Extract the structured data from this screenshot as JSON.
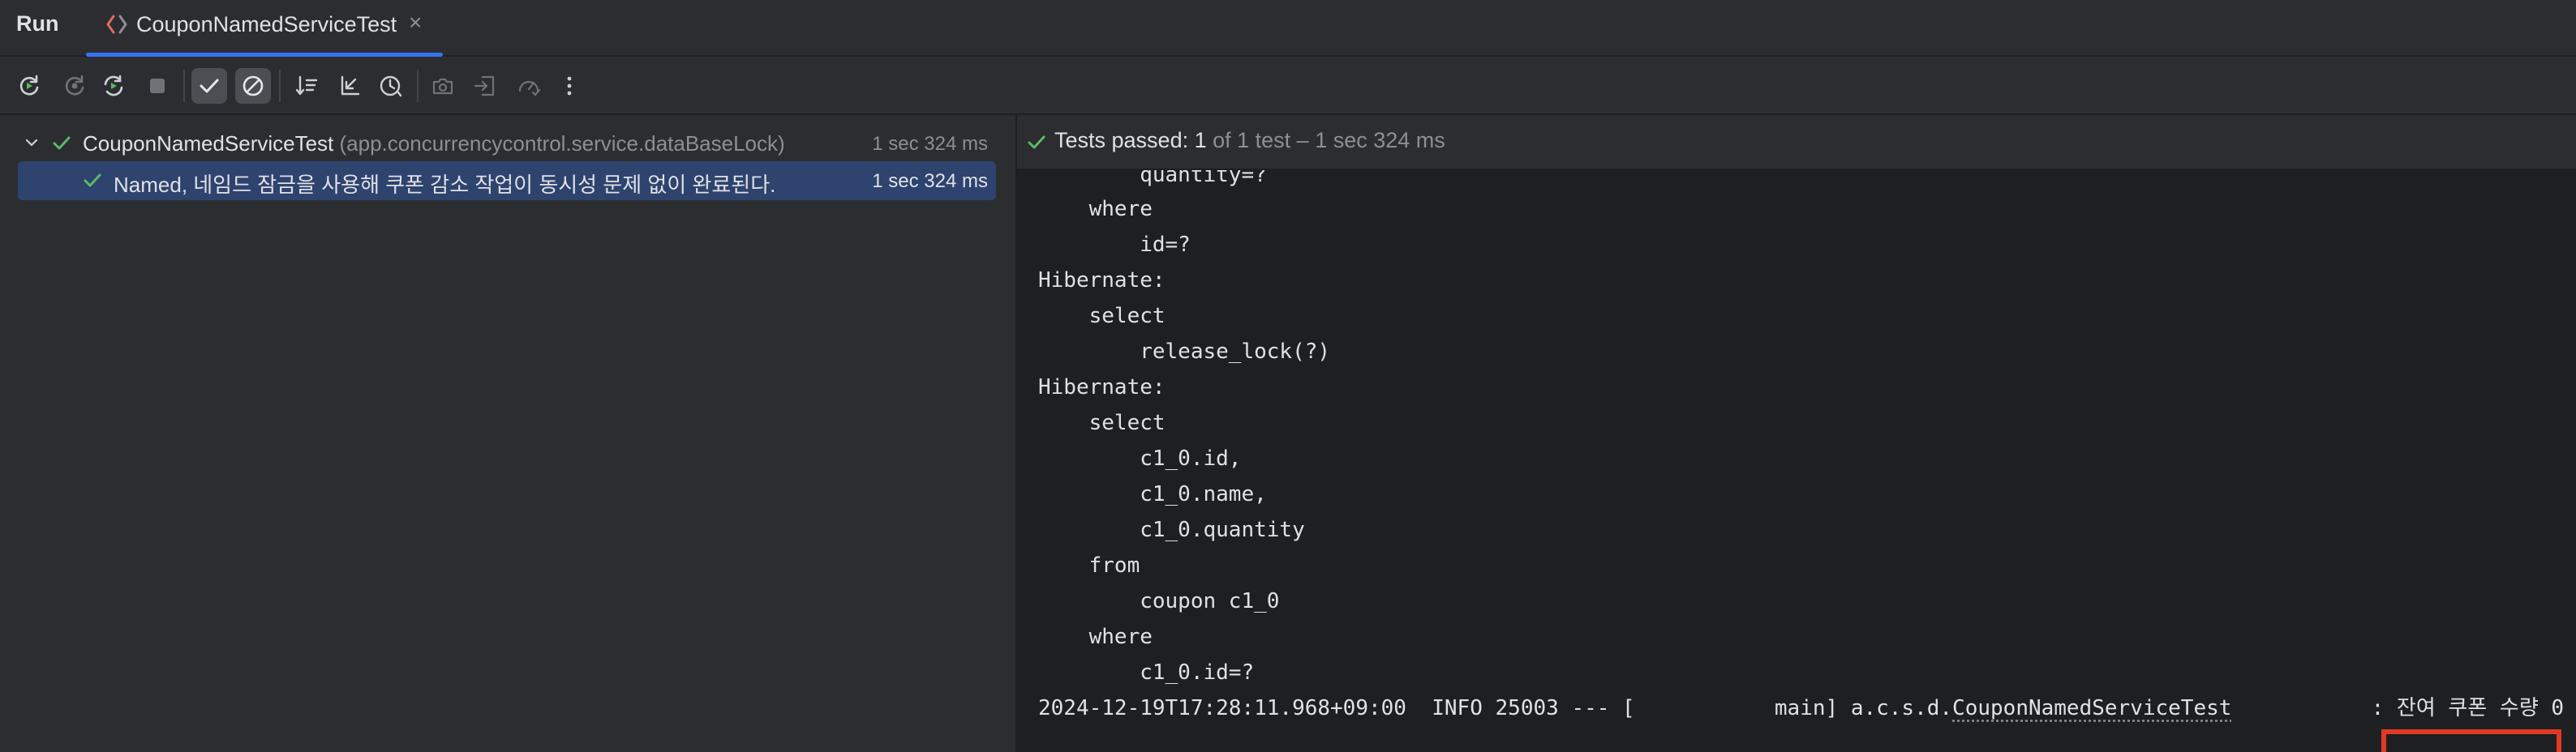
{
  "tabbar": {
    "run_label": "Run",
    "tab_title": "CouponNamedServiceTest",
    "close_glyph": "×"
  },
  "toolbar": {
    "buttons": [
      {
        "name": "rerun-icon"
      },
      {
        "name": "rerun-failed-icon"
      },
      {
        "name": "toggle-auto-test-icon"
      },
      {
        "name": "stop-icon"
      },
      {
        "name": "show-passed-icon"
      },
      {
        "name": "show-ignored-icon"
      },
      {
        "name": "sort-alphabetically-icon"
      },
      {
        "name": "collapse-all-icon"
      },
      {
        "name": "sort-by-duration-icon"
      },
      {
        "name": "camera-icon"
      },
      {
        "name": "import-tests-icon"
      },
      {
        "name": "gauge-icon"
      },
      {
        "name": "more-options-icon"
      }
    ]
  },
  "tree": {
    "root": {
      "name": "CouponNamedServiceTest",
      "package": "(app.concurrencycontrol.service.dataBaseLock)",
      "time": "1 sec 324 ms"
    },
    "child": {
      "name": "Named, 네임드 잠금을 사용해 쿠폰 감소 작업이 동시성 문제 없이 완료된다.",
      "time": "1 sec 324 ms"
    }
  },
  "status": {
    "label": "Tests passed: ",
    "count": "1",
    "rest": " of 1 test – 1 sec 324 ms"
  },
  "console": {
    "lines": [
      "        quantity=?",
      "    where",
      "        id=?",
      "Hibernate:",
      "    select",
      "        release_lock(?)",
      "Hibernate:",
      "    select",
      "        c1_0.id,",
      "        c1_0.name,",
      "        c1_0.quantity",
      "    from",
      "        coupon c1_0",
      "    where",
      "        c1_0.id=?"
    ],
    "log": {
      "prefix": "2024-12-19T17:28:11.968+09:00  INFO 25003 --- [           main] a.c.s.d.",
      "logger": "CouponNamedServiceTest",
      "gap": "           : ",
      "message": "잔여 쿠폰 수량 0"
    }
  },
  "colors": {
    "accent": "#3574f0",
    "success": "#5fb865",
    "highlight": "#e03a24",
    "selection": "#2e436e"
  }
}
